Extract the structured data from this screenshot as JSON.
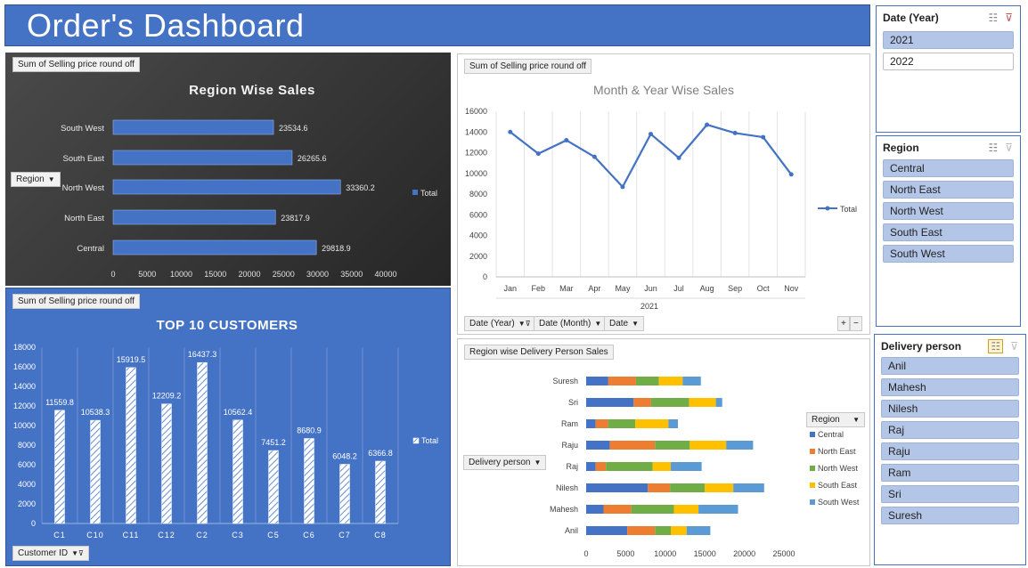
{
  "title": "Order's Dashboard",
  "colors": {
    "banner": "#4472c4",
    "bar_blue": "#4472c4",
    "dark_bg": "#333333",
    "central": "#4472c4",
    "north_east": "#ed7d31",
    "north_west": "#70ad47",
    "south_east": "#ffc000",
    "south_west": "#5b9bd5"
  },
  "region_chart": {
    "field_button": "Sum of Selling price round off",
    "axis_button": "Region",
    "chart_data": {
      "type": "bar",
      "title": "Region Wise Sales",
      "categories": [
        "South West",
        "South East",
        "North West",
        "North East",
        "Central"
      ],
      "series": [
        {
          "name": "Total",
          "values": [
            23534.6,
            26265.6,
            33360.2,
            23817.9,
            29818.9
          ]
        }
      ],
      "value_labels": [
        "23534.6",
        "26265.6",
        "33360.2",
        "23817.9",
        "29818.9"
      ],
      "xlim": [
        0,
        40000
      ],
      "ticks": [
        "0",
        "5000",
        "10000",
        "15000",
        "20000",
        "25000",
        "30000",
        "35000",
        "40000"
      ],
      "orientation": "horizontal",
      "legend": "right"
    }
  },
  "month_chart": {
    "field_button": "Sum of Selling price round off",
    "filter_buttons": [
      "Date (Year)",
      "Date (Month)",
      "Date"
    ],
    "chart_data": {
      "type": "line",
      "title": "Month & Year Wise Sales",
      "categories": [
        "Jan",
        "Feb",
        "Mar",
        "Apr",
        "May",
        "Jun",
        "Jul",
        "Aug",
        "Sep",
        "Oct",
        "Nov"
      ],
      "group_label": "2021",
      "series": [
        {
          "name": "Total",
          "values": [
            14000,
            11900,
            13200,
            11600,
            8700,
            13800,
            11500,
            14700,
            13900,
            13500,
            9900
          ]
        }
      ],
      "ylim": [
        0,
        16000
      ],
      "ticks": [
        "0",
        "2000",
        "4000",
        "6000",
        "8000",
        "10000",
        "12000",
        "14000",
        "16000"
      ],
      "legend": "right"
    }
  },
  "customers_chart": {
    "field_button": "Sum of Selling price round off",
    "axis_button": "Customer ID",
    "chart_data": {
      "type": "bar",
      "title": "TOP 10 CUSTOMERS",
      "categories": [
        "C1",
        "C10",
        "C11",
        "C12",
        "C2",
        "C3",
        "C5",
        "C6",
        "C7",
        "C8"
      ],
      "series": [
        {
          "name": "Total",
          "values": [
            11559.8,
            10538.3,
            15919.5,
            12209.2,
            16437.3,
            10562.4,
            7451.2,
            8680.9,
            6048.2,
            6366.8
          ]
        }
      ],
      "value_labels": [
        "11559.8",
        "10538.3",
        "15919.5",
        "12209.2",
        "16437.3",
        "10562.4",
        "7451.2",
        "8680.9",
        "6048.2",
        "6366.8"
      ],
      "ylim": [
        0,
        18000
      ],
      "ticks": [
        "0",
        "2000",
        "4000",
        "6000",
        "8000",
        "10000",
        "12000",
        "14000",
        "16000",
        "18000"
      ],
      "legend": "right"
    }
  },
  "delivery_chart": {
    "field_button": "Region wise Delivery Person Sales",
    "axis_button": "Delivery person",
    "legend_button": "Region",
    "chart_data": {
      "type": "bar",
      "stacked": true,
      "orientation": "horizontal",
      "categories": [
        "Suresh",
        "Sri",
        "Ram",
        "Raju",
        "Raj",
        "Nilesh",
        "Mahesh",
        "Anil"
      ],
      "series": [
        {
          "name": "Central",
          "values": [
            2800,
            6000,
            1200,
            3000,
            1200,
            7800,
            2200,
            5200
          ]
        },
        {
          "name": "North East",
          "values": [
            3500,
            2200,
            1600,
            5700,
            1300,
            2800,
            3500,
            3500
          ]
        },
        {
          "name": "North West",
          "values": [
            2900,
            4800,
            3400,
            4400,
            5900,
            4400,
            5400,
            2000
          ]
        },
        {
          "name": "South East",
          "values": [
            3000,
            3400,
            4200,
            4600,
            2300,
            3600,
            3100,
            2000
          ]
        },
        {
          "name": "South West",
          "values": [
            2300,
            800,
            1200,
            3400,
            3900,
            3900,
            5000,
            3000
          ]
        }
      ],
      "xlim": [
        0,
        25000
      ],
      "ticks": [
        "0",
        "5000",
        "10000",
        "15000",
        "20000",
        "25000"
      ],
      "legend": "right"
    }
  },
  "slicers": {
    "year": {
      "title": "Date (Year)",
      "items": [
        "2021",
        "2022"
      ]
    },
    "region": {
      "title": "Region",
      "items": [
        "Central",
        "North East",
        "North West",
        "South East",
        "South West"
      ]
    },
    "delivery": {
      "title": "Delivery person",
      "items": [
        "Anil",
        "Mahesh",
        "Nilesh",
        "Raj",
        "Raju",
        "Ram",
        "Sri",
        "Suresh"
      ]
    }
  },
  "icons": [
    "multi-select-icon",
    "clear-filter-icon",
    "filter-icon",
    "dropdown-icon",
    "plus-icon",
    "minus-icon"
  ],
  "expand_buttons": [
    "+",
    "−"
  ]
}
